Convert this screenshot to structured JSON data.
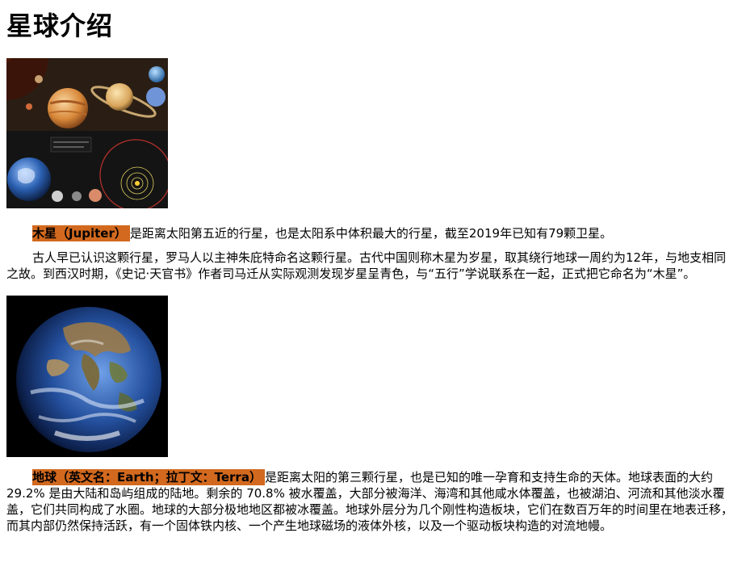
{
  "page": {
    "title": "星球介绍"
  },
  "jupiter": {
    "name_highlight": "木星（Jupiter）",
    "intro_rest": "是距离太阳第五近的行星，也是太阳系中体积最大的行星，截至2019年已知有79颗卫星。",
    "history": "古人早已认识这颗行星，罗马人以主神朱庇特命名这颗行星。古代中国则称木星为岁星，取其绕行地球一周约为12年，与地支相同之故。到西汉时期，《史记·天官书》作者司马迁从实际观测发现岁星呈青色，与“五行”学说联系在一起，正式把它命名为“木星”。"
  },
  "earth": {
    "name_highlight": "地球（英文名：Earth；拉丁文：Terra）",
    "description": "是距离太阳的第三颗行星，也是已知的唯一孕育和支持生命的天体。地球表面的大约 29.2% 是由大陆和岛屿组成的陆地。剩余的 70.8% 被水覆盖，大部分被海洋、海湾和其他咸水体覆盖，也被湖泊、河流和其他淡水覆盖，它们共同构成了水圈。地球的大部分极地地区都被冰覆盖。地球外层分为几个刚性构造板块，它们在数百万年的时间里在地表迁移，而其内部仍然保持活跃，有一个固体铁内核、一个产生地球磁场的液体外核，以及一个驱动板块构造的对流地幔。"
  },
  "colors": {
    "highlight": "#d2691e",
    "space_dark": "#000000"
  },
  "icons": {
    "jupiter_figure": "solar-system-illustration",
    "earth_figure": "earth-globe-photo"
  }
}
